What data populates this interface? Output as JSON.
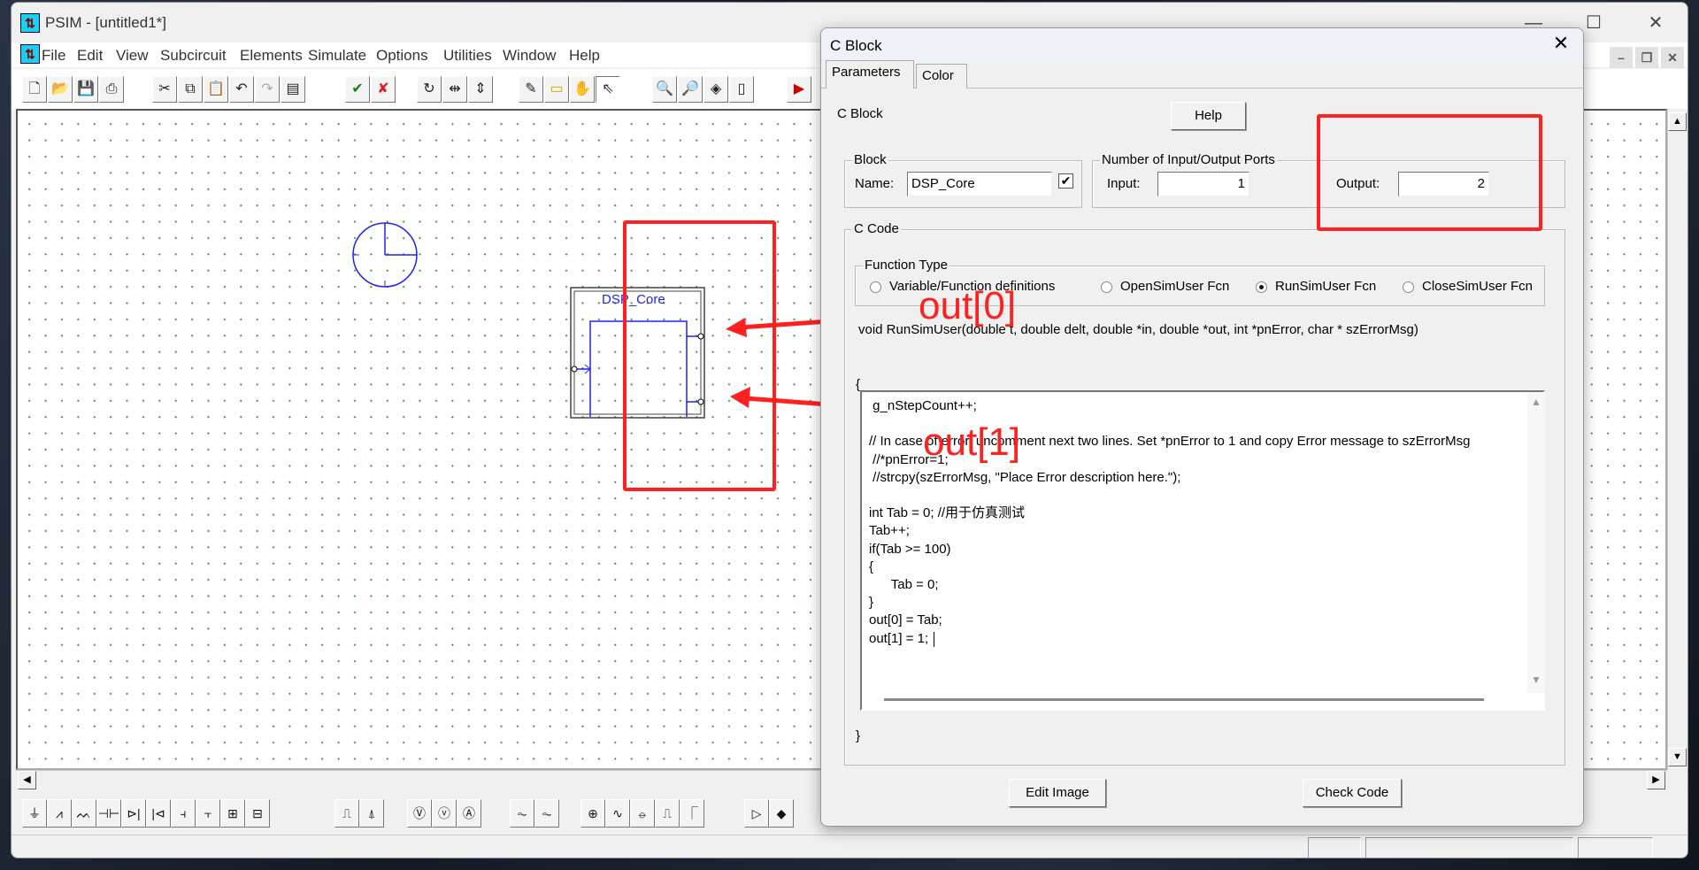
{
  "app": {
    "title": "PSIM - [untitled1*]",
    "icon": "psim-app-icon"
  },
  "window_controls": {
    "minimize": "—",
    "maximize": "☐",
    "close": "✕"
  },
  "menu": [
    {
      "label": "File",
      "key": "F"
    },
    {
      "label": "Edit",
      "key": "E"
    },
    {
      "label": "View",
      "key": "V"
    },
    {
      "label": "Subcircuit",
      "key": "b"
    },
    {
      "label": "Elements",
      "key": "l"
    },
    {
      "label": "Simulate",
      "key": "S"
    },
    {
      "label": "Options",
      "key": "O"
    },
    {
      "label": "Utilities",
      "key": "t"
    },
    {
      "label": "Window",
      "key": "W"
    },
    {
      "label": "Help",
      "key": "H"
    }
  ],
  "mdi_controls": {
    "minimize": "–",
    "restore": "❐",
    "close": "✕"
  },
  "toolbar": [
    {
      "icon": "new-file-icon",
      "glyph": "🗋"
    },
    {
      "icon": "open-folder-icon",
      "glyph": "📂"
    },
    {
      "icon": "save-icon",
      "glyph": "💾"
    },
    {
      "icon": "print-icon",
      "glyph": "⎙"
    },
    {
      "icon": "cut-icon",
      "glyph": "✂"
    },
    {
      "icon": "copy-icon",
      "glyph": "⧉"
    },
    {
      "icon": "paste-icon",
      "glyph": "📋",
      "disabled": true
    },
    {
      "icon": "undo-icon",
      "glyph": "↶"
    },
    {
      "icon": "redo-icon",
      "glyph": "↷",
      "disabled": true
    },
    {
      "icon": "clipboard-icon",
      "glyph": "▤"
    },
    {
      "icon": "check-icon",
      "glyph": "✔",
      "color": "#0a8a0a"
    },
    {
      "icon": "cancel-icon",
      "glyph": "✘",
      "color": "#e02020"
    },
    {
      "icon": "rotate-icon",
      "glyph": "↻"
    },
    {
      "icon": "flip-horizontal-icon",
      "glyph": "⇹"
    },
    {
      "icon": "flip-vertical-icon",
      "glyph": "⇕"
    },
    {
      "icon": "wire-pencil-icon",
      "glyph": "✎"
    },
    {
      "icon": "label-icon",
      "glyph": "▭",
      "color": "#c8a800"
    },
    {
      "icon": "pan-hand-icon",
      "glyph": "✋"
    },
    {
      "icon": "pointer-icon",
      "glyph": "⇖",
      "active": true
    },
    {
      "icon": "zoom-in-icon",
      "glyph": "🔍"
    },
    {
      "icon": "zoom-out-icon",
      "glyph": "🔎"
    },
    {
      "icon": "zoom-fit-icon",
      "glyph": "◈"
    },
    {
      "icon": "page-icon",
      "glyph": "▯"
    },
    {
      "icon": "simulate-icon",
      "glyph": "▶",
      "color": "#c00"
    }
  ],
  "schematic": {
    "clock_icon": "clock-icon",
    "block_label": "DSP_Core",
    "wire_color": "#2020ff"
  },
  "annotations": {
    "label0": "out[0]",
    "label1": "out[1]",
    "color": "#ff2020"
  },
  "element_toolbar": [
    {
      "icon": "ground-icon",
      "glyph": "⏚"
    },
    {
      "icon": "resistor-icon",
      "glyph": "⩘"
    },
    {
      "icon": "inductor-icon",
      "glyph": "ᨓ"
    },
    {
      "icon": "capacitor-icon",
      "glyph": "⊣⊢"
    },
    {
      "icon": "diode-icon",
      "glyph": "⊳|"
    },
    {
      "icon": "zener-icon",
      "glyph": "|⊲"
    },
    {
      "icon": "mosfet-icon",
      "glyph": "⫞"
    },
    {
      "icon": "igbt-icon",
      "glyph": "⫟"
    },
    {
      "icon": "switch-module-icon",
      "glyph": "⊞"
    },
    {
      "icon": "switch-module2-icon",
      "glyph": "⊟"
    },
    {
      "icon": "pulse-icon",
      "glyph": "⎍"
    },
    {
      "icon": "probe-icon",
      "glyph": "⍋"
    },
    {
      "icon": "voltmeter-icon",
      "glyph": "Ⓥ"
    },
    {
      "icon": "voltage-probe-icon",
      "glyph": "ⓥ"
    },
    {
      "icon": "ammeter-icon",
      "glyph": "Ⓐ"
    },
    {
      "icon": "scope-icon",
      "glyph": "⏦"
    },
    {
      "icon": "scope2-icon",
      "glyph": "⏦"
    },
    {
      "icon": "dc-source-icon",
      "glyph": "⊕"
    },
    {
      "icon": "ac-source-icon",
      "glyph": "∿"
    },
    {
      "icon": "sine-source-icon",
      "glyph": "⦵"
    },
    {
      "icon": "square-source-icon",
      "glyph": "⎍"
    },
    {
      "icon": "step-source-icon",
      "glyph": "⎾"
    },
    {
      "icon": "comparator-icon",
      "glyph": "▷"
    },
    {
      "icon": "current-source-icon",
      "glyph": "◆"
    }
  ],
  "dialog": {
    "title": "C Block",
    "tabs": [
      {
        "label": "Parameters",
        "selected": true
      },
      {
        "label": "Color"
      }
    ],
    "heading": "C Block",
    "help_button": "Help",
    "block_group": {
      "label": "Block",
      "name_label": "Name:",
      "name_value": "DSP_Core",
      "show_checked": true
    },
    "ports_group": {
      "label": "Number of Input/Output Ports",
      "input_label": "Input:",
      "input_value": "1",
      "output_label": "Output:",
      "output_value": "2"
    },
    "code_group": {
      "label": "C Code"
    },
    "function_type": {
      "label": "Function Type",
      "options": [
        {
          "label": "Variable/Function definitions",
          "selected": false
        },
        {
          "label": "OpenSimUser Fcn",
          "selected": false
        },
        {
          "label": "RunSimUser Fcn",
          "selected": true
        },
        {
          "label": "CloseSimUser Fcn",
          "selected": false
        }
      ]
    },
    "signature": "void RunSimUser(double t, double delt, double *in, double *out, int *pnError, char * szErrorMsg)",
    "open_brace": "{",
    "close_brace": "}",
    "code_lines": [
      " g_nStepCount++;",
      "",
      "// In case of error, uncomment next two lines. Set *pnError to 1 and copy Error message to szErrorMsg",
      " //*pnError=1;",
      " //strcpy(szErrorMsg, \"Place Error description here.\");",
      "",
      "int Tab = 0; //用于仿真测试",
      "Tab++;",
      "if(Tab >= 100)",
      "{",
      "      Tab = 0;",
      "}",
      "out[0] = Tab;",
      "out[1] = 1;"
    ],
    "edit_image_button": "Edit Image",
    "check_code_button": "Check Code",
    "close": "✕"
  }
}
